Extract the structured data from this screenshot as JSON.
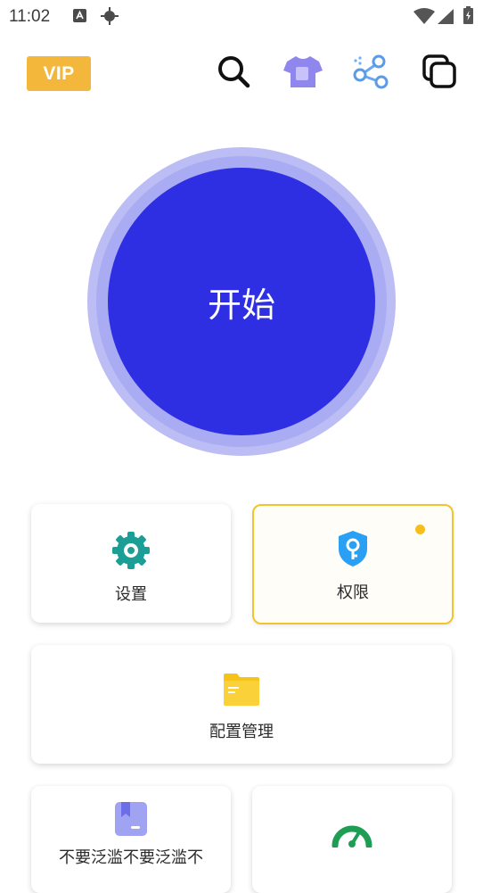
{
  "status_bar": {
    "time": "11:02",
    "icons": [
      "app-notification-icon",
      "location-icon",
      "wifi-icon",
      "signal-icon",
      "battery-icon"
    ]
  },
  "toolbar": {
    "vip_label": "VIP",
    "icons": [
      "search-icon",
      "theme-shirt-icon",
      "share-icon",
      "copy-windows-icon"
    ]
  },
  "main": {
    "start_label": "开始"
  },
  "cards": {
    "settings": {
      "label": "设置",
      "icon": "gear-icon"
    },
    "permissions": {
      "label": "权限",
      "icon": "shield-icon",
      "badge": "dot"
    },
    "config": {
      "label": "配置管理",
      "icon": "folder-icon"
    },
    "notice": {
      "label": "不要泛滥不要泛滥不",
      "icon": "bookmark-icon"
    },
    "speed": {
      "label": "",
      "icon": "speedometer-icon"
    }
  },
  "colors": {
    "vip": "#f2b73b",
    "start_inner": "#2e2ee3",
    "start_ring": "#bbbdf4",
    "gear": "#1a9e95",
    "shield": "#2aa0f5",
    "folder": "#f6c31b",
    "badge_dot": "#f6be1b",
    "speed": "#1e9e55",
    "bookmark": "#9fa3f2"
  }
}
